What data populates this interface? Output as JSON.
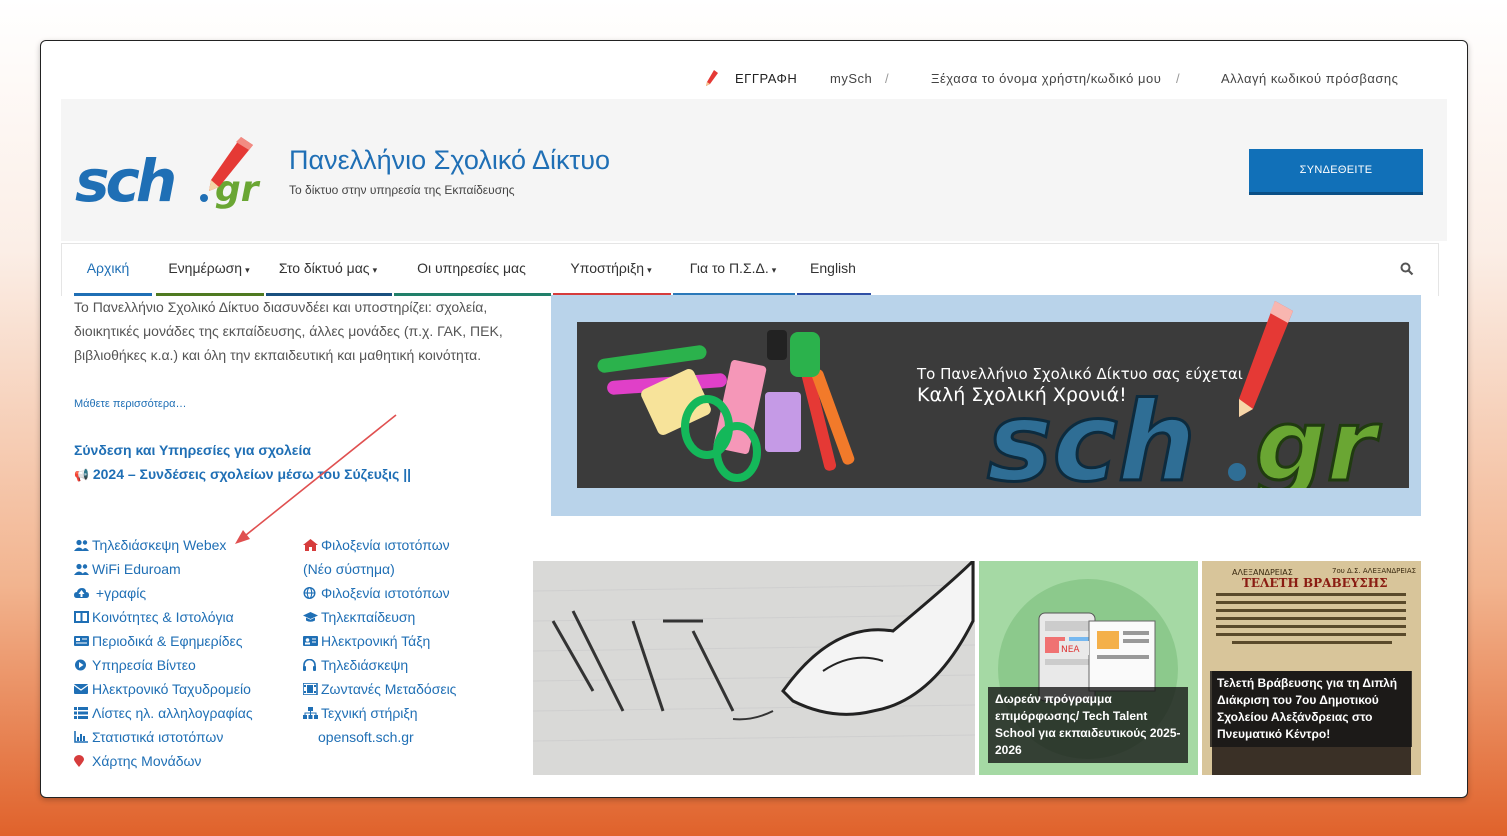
{
  "topbar": {
    "register": "ΕΓΓΡΑΦΗ",
    "mysch": "mySch",
    "forgot": "Ξέχασα το όνομα χρήστη/κωδικό μου",
    "change_pw": "Αλλαγή κωδικού πρόσβασης",
    "separator": "/"
  },
  "header": {
    "logo_text": "sch",
    "logo_suffix": "gr",
    "title": "Πανελλήνιο Σχολικό Δίκτυο",
    "subtitle": "Το δίκτυο στην υπηρεσία της Εκπαίδευσης",
    "connect_button": "ΣΥΝΔΕΘΕΙΤΕ"
  },
  "nav": {
    "tabs": [
      {
        "label": "Αρχική",
        "color": "#1f6fb5"
      },
      {
        "label": "Ενημέρωση",
        "color": "#333333",
        "caret": "▾"
      },
      {
        "label": "Στο δίκτυό μας",
        "color": "#333333",
        "caret": "▾"
      },
      {
        "label": "Οι υπηρεσίες μας",
        "color": "#333333"
      },
      {
        "label": "Υποστήριξη",
        "color": "#333333",
        "caret": "▾"
      },
      {
        "label": "Για το Π.Σ.Δ.",
        "color": "#333333",
        "caret": "▾"
      },
      {
        "label": "English",
        "color": "#333333"
      }
    ],
    "bar_colors": [
      "#1f6fb5",
      "#4f7a21",
      "#19507f",
      "#21806a",
      "#d63c3c",
      "#2b78b9",
      "#2f4fa5"
    ]
  },
  "intro": {
    "text": "Το Πανελλήνιο Σχολικό Δίκτυο διασυνδέει και υποστηρίζει: σχολεία, διοικητικές μονάδες της εκπαίδευσης,  άλλες μονάδες (π.χ. ΓΑΚ, ΠΕΚ, βιβλιοθήκες κ.α.) και όλη την εκπαιδευτική και μαθητική κοινότητα.",
    "more": "Μάθετε περισσότερα…"
  },
  "connections": {
    "title": "Σύνδεση και Υπηρεσίες για σχολεία",
    "link": "2024 – Συνδέσεις σχολείων μέσω του Σύζευξις ||",
    "link_icon": "📢"
  },
  "links_left": [
    {
      "label": "Τηλεδιάσκεψη Webex",
      "icon": "users-icon"
    },
    {
      "label": "WiFi Eduroam",
      "icon": "users-icon"
    },
    {
      "label": "+γραφίς",
      "icon": "cloud-upload-icon"
    },
    {
      "label": "Κοινότητες & Ιστολόγια",
      "icon": "columns-icon"
    },
    {
      "label": "Περιοδικά & Εφημερίδες",
      "icon": "newspaper-icon"
    },
    {
      "label": "Υπηρεσία Βίντεο",
      "icon": "play-circle-icon"
    },
    {
      "label": "Ηλεκτρονικό Ταχυδρομείο",
      "icon": "envelope-icon"
    },
    {
      "label": "Λίστες ηλ. αλληλογραφίας",
      "icon": "list-icon"
    },
    {
      "label": "Στατιστικά ιστοτόπων",
      "icon": "bar-chart-icon"
    },
    {
      "label": "Χάρτης Μονάδων",
      "icon": "map-marker-icon"
    }
  ],
  "links_right": [
    {
      "label": "Φιλοξενία ιστοτόπων",
      "icon": "home-icon"
    },
    {
      "label": "(Νέο σύστημα)",
      "icon": ""
    },
    {
      "label": "Φιλοξενία ιστοτόπων",
      "icon": "globe-icon"
    },
    {
      "label": "Τηλεκπαίδευση",
      "icon": "graduation-cap-icon"
    },
    {
      "label": "Ηλεκτρονική Τάξη",
      "icon": "id-card-icon"
    },
    {
      "label": "Τηλεδιάσκεψη",
      "icon": "headphones-icon"
    },
    {
      "label": "Ζωντανές Μεταδόσεις",
      "icon": "film-icon"
    },
    {
      "label": "Τεχνική στήριξη",
      "icon": "sitemap-icon"
    },
    {
      "label": "opensoft.sch.gr",
      "icon": ""
    }
  ],
  "banner": {
    "line1": "Το Πανελλήνιο Σχολικό Δίκτυο σας εύχεται",
    "line2": "Καλή Σχολική Χρονιά!",
    "logo_text": "sch",
    "logo_suffix": "gr"
  },
  "news": [
    {
      "caption": ""
    },
    {
      "caption": "Δωρεάν πρόγραμμα επιμόρφωσης/ Tech Talent School για εκπαιδευτικούς 2025-2026",
      "badge": "ΝΕΑ"
    },
    {
      "caption": "Τελετή Βράβευσης για τη Διπλή Διάκριση του 7ου Δημοτικού Σχολείου Αλεξάνδρειας στο Πνευματικό Κέντρο!",
      "poster_title": "ΤΕΛΕΤΗ ΒΡΑΒΕΥΣΗΣ",
      "poster_school": "7ου Δ.Σ. ΑΛΕΞΑΝΔΡΕΙΑΣ",
      "poster_school_short": "ΑΛΕΞΑΝΔΡΕΙΑΣ"
    }
  ]
}
